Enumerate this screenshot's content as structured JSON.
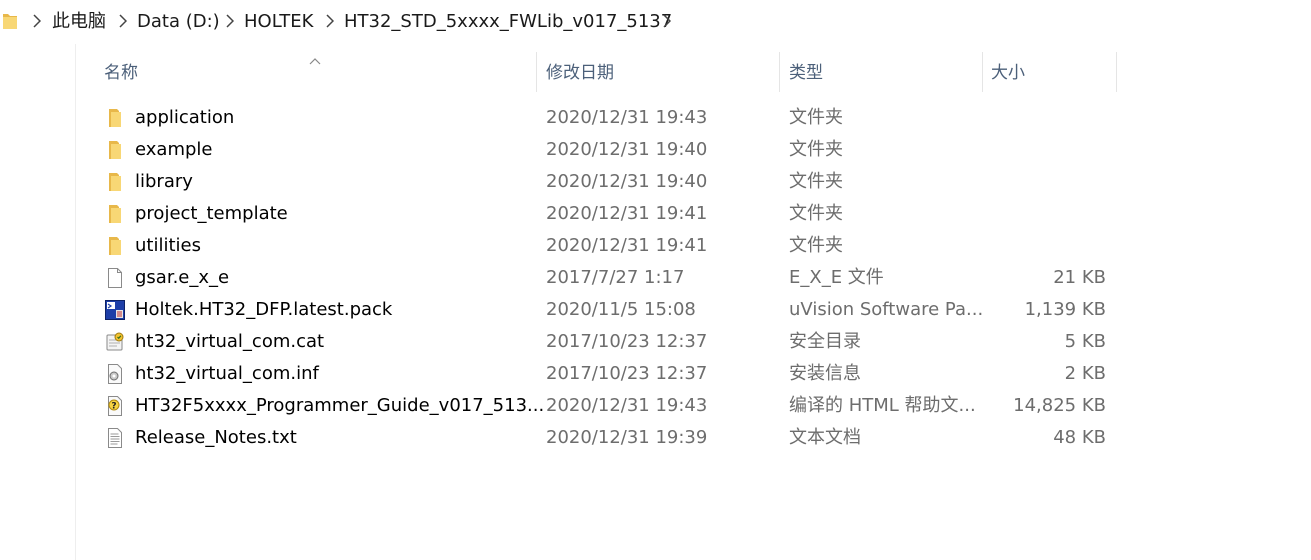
{
  "address_bar": {
    "path": [
      "此电脑",
      "Data (D:)",
      "HOLTEK",
      "HT32_STD_5xxxx_FWLib_v017_5137"
    ]
  },
  "columns": {
    "name": "名称",
    "date": "修改日期",
    "type": "类型",
    "size": "大小"
  },
  "sort": {
    "column": "name",
    "direction": "ascending"
  },
  "files": [
    {
      "name": "application",
      "date": "2020/12/31 19:43",
      "type": "文件夹",
      "size": "",
      "icon": "folder-icon"
    },
    {
      "name": "example",
      "date": "2020/12/31 19:40",
      "type": "文件夹",
      "size": "",
      "icon": "folder-icon"
    },
    {
      "name": "library",
      "date": "2020/12/31 19:40",
      "type": "文件夹",
      "size": "",
      "icon": "folder-icon"
    },
    {
      "name": "project_template",
      "date": "2020/12/31 19:41",
      "type": "文件夹",
      "size": "",
      "icon": "folder-icon"
    },
    {
      "name": "utilities",
      "date": "2020/12/31 19:41",
      "type": "文件夹",
      "size": "",
      "icon": "folder-icon"
    },
    {
      "name": "gsar.e_x_e",
      "date": "2017/7/27 1:17",
      "type": "E_X_E 文件",
      "size": "21 KB",
      "icon": "blank-file-icon"
    },
    {
      "name": "Holtek.HT32_DFP.latest.pack",
      "date": "2020/11/5 15:08",
      "type": "uVision Software Pa...",
      "size": "1,139 KB",
      "icon": "uvision-pack-icon"
    },
    {
      "name": "ht32_virtual_com.cat",
      "date": "2017/10/23 12:37",
      "type": "安全目录",
      "size": "5 KB",
      "icon": "security-catalog-icon"
    },
    {
      "name": "ht32_virtual_com.inf",
      "date": "2017/10/23 12:37",
      "type": "安装信息",
      "size": "2 KB",
      "icon": "setup-info-icon"
    },
    {
      "name": "HT32F5xxxx_Programmer_Guide_v017_513...",
      "date": "2020/12/31 19:43",
      "type": "编译的 HTML 帮助文...",
      "size": "14,825 KB",
      "icon": "chm-help-icon"
    },
    {
      "name": "Release_Notes.txt",
      "date": "2020/12/31 19:39",
      "type": "文本文档",
      "size": "48 KB",
      "icon": "text-file-icon"
    }
  ],
  "colors": {
    "header_text": "#4c607a",
    "secondary_text": "#6d6d6d",
    "folder_yellow": "#f8d775"
  }
}
